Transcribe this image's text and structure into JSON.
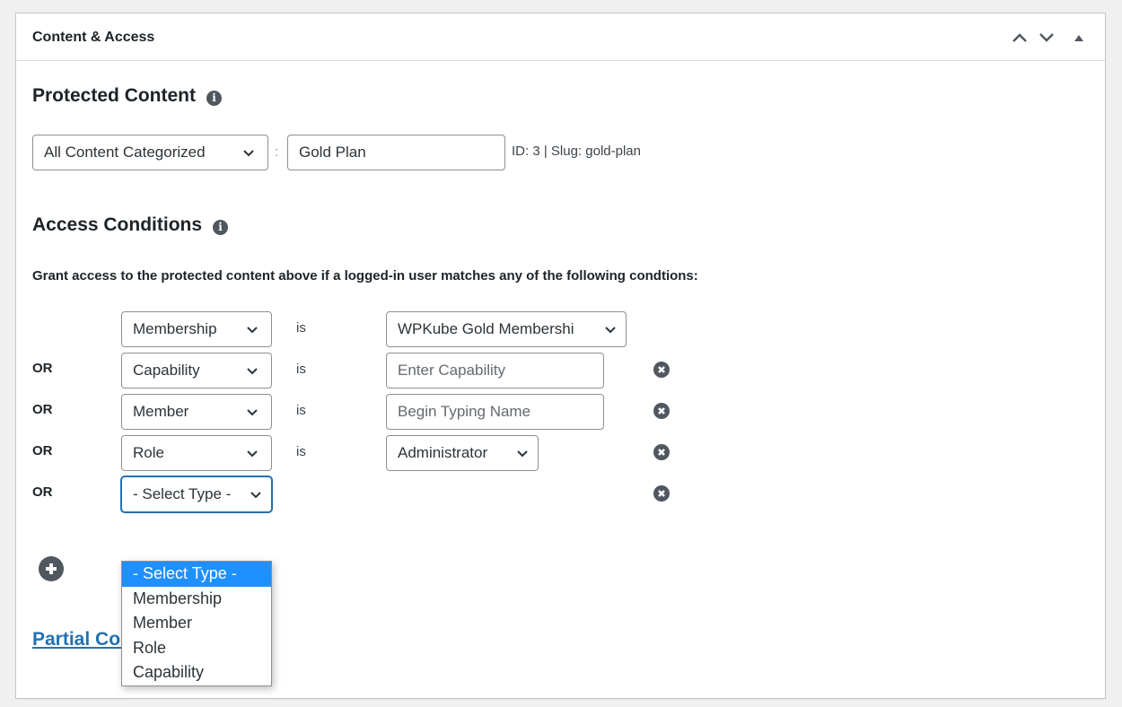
{
  "panel": {
    "title": "Content & Access",
    "controls": [
      {
        "name": "move-up",
        "icon": "chevron-up-icon"
      },
      {
        "name": "move-down",
        "icon": "chevron-down-icon"
      },
      {
        "name": "toggle-panel",
        "icon": "triangle-up-icon"
      }
    ]
  },
  "protected_content": {
    "heading": "Protected Content",
    "info_icon": "info-icon",
    "type_select": "All Content Categorized",
    "separator": ":",
    "term_value": "Gold Plan",
    "meta": "ID: 3 | Slug: gold-plan"
  },
  "access_conditions": {
    "heading": "Access Conditions",
    "info_icon": "info-icon",
    "description": "Grant access to the protected content above if a logged-in user matches any of the following condtions:",
    "rows": [
      {
        "prefix": "",
        "type": "Membership",
        "operator": "is",
        "value_kind": "select",
        "value": "WPKube Gold Membershi",
        "removable": false
      },
      {
        "prefix": "OR",
        "type": "Capability",
        "operator": "is",
        "value_kind": "input",
        "value": "",
        "placeholder": "Enter Capability",
        "removable": true
      },
      {
        "prefix": "OR",
        "type": "Member",
        "operator": "is",
        "value_kind": "input",
        "value": "",
        "placeholder": "Begin Typing Name",
        "removable": true
      },
      {
        "prefix": "OR",
        "type": "Role",
        "operator": "is",
        "value_kind": "select",
        "value": "Administrator",
        "removable": true
      },
      {
        "prefix": "OR",
        "type": "- Select Type -",
        "operator": "",
        "value_kind": "none",
        "value": "",
        "removable": true
      }
    ],
    "open_dropdown": {
      "options": [
        "- Select Type -",
        "Membership",
        "Member",
        "Role",
        "Capability"
      ],
      "selected_index": 0
    },
    "add_icon": "plus-circle-icon",
    "remove_icon": "remove-circle-icon"
  },
  "partial_content_link": "Partial Content Codes",
  "colors": {
    "accent": "#2271b1",
    "dropdown_highlight": "#1e90ff",
    "icon_gray": "#50575e",
    "background": "#f0f0f1"
  }
}
